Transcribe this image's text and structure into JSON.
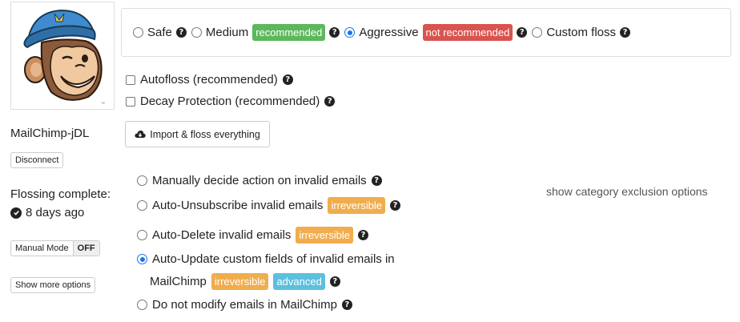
{
  "mode": {
    "options": [
      {
        "label": "Safe",
        "checked": false
      },
      {
        "label": "Medium",
        "badge": "recommended",
        "checked": false
      },
      {
        "label": "Aggressive",
        "badge": "not recommended",
        "checked": true
      },
      {
        "label": "Custom floss",
        "checked": false
      }
    ]
  },
  "settings": {
    "autofloss": "Autofloss (recommended)",
    "decay": "Decay Protection (recommended)"
  },
  "import_button": "Import & floss everything",
  "account": {
    "name": "MailChimp-jDL",
    "disconnect": "Disconnect",
    "floss_status": "Flossing complete:",
    "floss_time": "8 days ago",
    "manual_mode": "Manual Mode",
    "manual_state": "OFF",
    "show_more": "Show more options"
  },
  "invalid": {
    "options": [
      {
        "label": "Manually decide action on invalid emails",
        "checked": false
      },
      {
        "label": "Auto-Unsubscribe invalid emails",
        "badge": "irreversible",
        "checked": false
      },
      {
        "label": "Auto-Delete invalid emails",
        "badge": "irreversible",
        "checked": false
      },
      {
        "label": "Auto-Update custom fields of invalid emails in",
        "label_cont": "MailChimp",
        "badges": [
          "irreversible",
          "advanced"
        ],
        "checked": true
      },
      {
        "label": "Do not modify emails in MailChimp",
        "checked": false
      }
    ]
  },
  "exclusion_link": "show category exclusion options",
  "colors": {
    "green": "#5cb85c",
    "red": "#d9534f",
    "orange": "#f0ad4e",
    "blue": "#5bc0de",
    "radio_accent": "#1a73e8"
  }
}
